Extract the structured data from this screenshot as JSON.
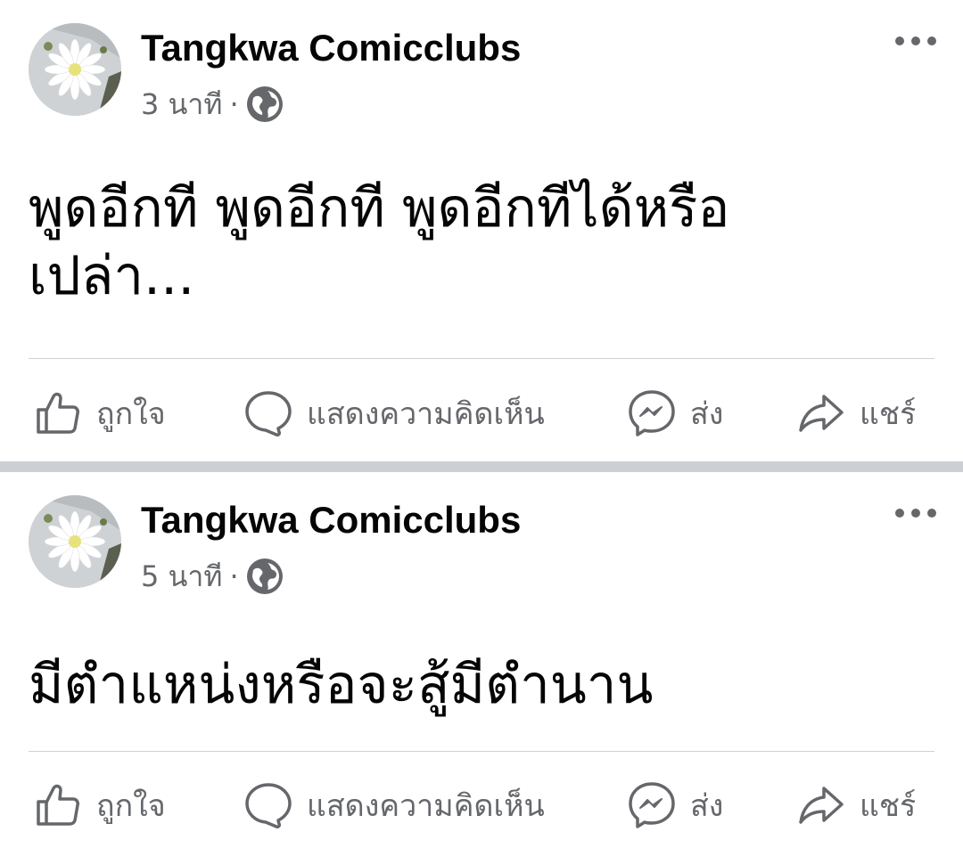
{
  "posts": [
    {
      "author": "Tangkwa Comicclubs",
      "time": "3 นาที",
      "separator": "·",
      "privacy_icon": "globe-icon",
      "text_lines": [
        "พูดอีกที พูดอีกที พูดอีกทีได้หรือ",
        "เปล่า..."
      ],
      "actions": {
        "like": "ถูกใจ",
        "comment": "แสดงความคิดเห็น",
        "send": "ส่ง",
        "share": "แชร์"
      }
    },
    {
      "author": "Tangkwa Comicclubs",
      "time": "5 นาที",
      "separator": "·",
      "privacy_icon": "globe-icon",
      "text_lines": [
        "มีตำแหน่งหรือจะสู้มีตำนาน"
      ],
      "actions": {
        "like": "ถูกใจ",
        "comment": "แสดงความคิดเห็น",
        "send": "ส่ง",
        "share": "แชร์"
      }
    }
  ],
  "colors": {
    "text": "#050505",
    "secondary": "#65676b",
    "separator": "#ccd0d5",
    "divider": "#ced0d4"
  }
}
